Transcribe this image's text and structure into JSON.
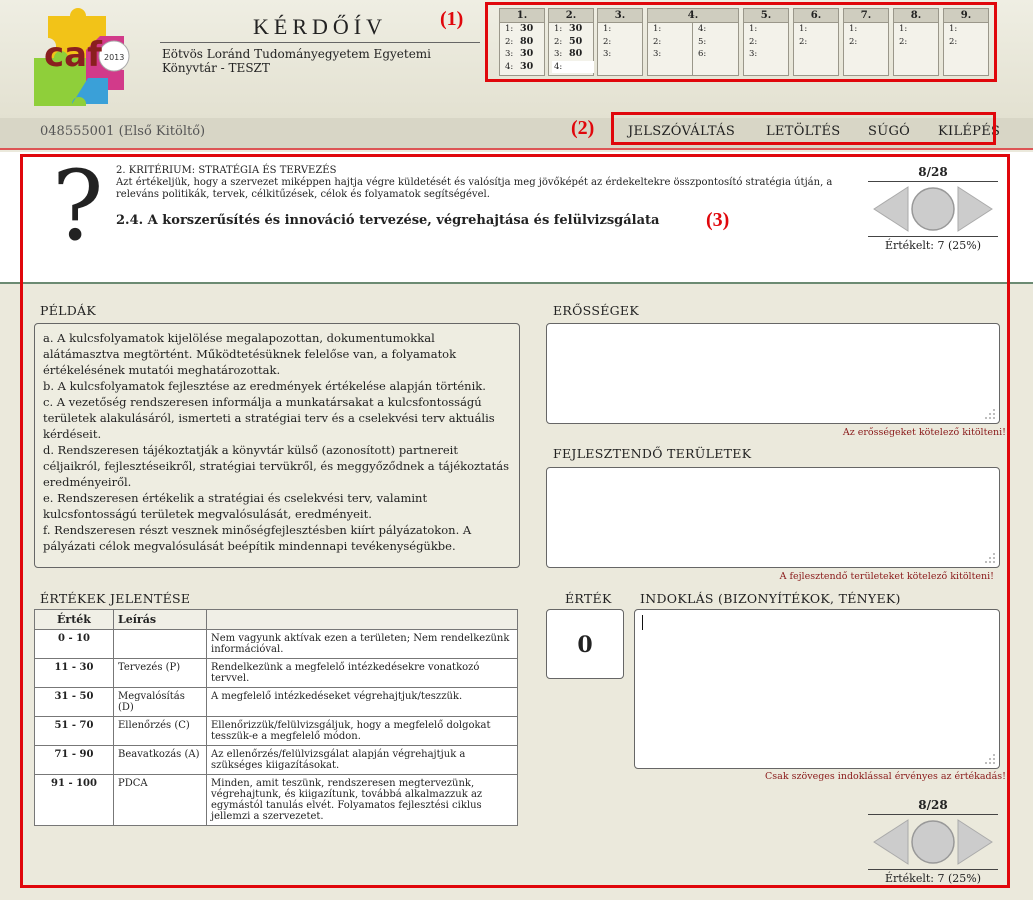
{
  "header": {
    "title": "KÉRDŐÍV",
    "subtitle": "Eötvös Loránd Tudományegyetem Egyetemi Könyvtár - TESZT",
    "logo_text": "caf",
    "logo_year": "2013"
  },
  "nav_grid": {
    "categories": [
      {
        "label": "1.",
        "items": [
          {
            "n": "1:",
            "v": "30"
          },
          {
            "n": "2:",
            "v": "80"
          },
          {
            "n": "3:",
            "v": "30"
          },
          {
            "n": "4:",
            "v": "30"
          }
        ]
      },
      {
        "label": "2.",
        "items": [
          {
            "n": "1:",
            "v": "30"
          },
          {
            "n": "2:",
            "v": "50"
          },
          {
            "n": "3:",
            "v": "80"
          },
          {
            "n": "4:",
            "v": ""
          }
        ]
      },
      {
        "label": "3.",
        "items": [
          {
            "n": "1:",
            "v": ""
          },
          {
            "n": "2:",
            "v": ""
          },
          {
            "n": "3:",
            "v": ""
          }
        ]
      },
      {
        "label": "4.",
        "items": [
          {
            "n": "1:",
            "v": ""
          },
          {
            "n": "2:",
            "v": ""
          },
          {
            "n": "3:",
            "v": ""
          },
          {
            "n": "4:",
            "v": ""
          },
          {
            "n": "5:",
            "v": ""
          },
          {
            "n": "6:",
            "v": ""
          }
        ]
      },
      {
        "label": "5.",
        "items": [
          {
            "n": "1:",
            "v": ""
          },
          {
            "n": "2:",
            "v": ""
          },
          {
            "n": "3:",
            "v": ""
          }
        ]
      },
      {
        "label": "6.",
        "items": [
          {
            "n": "1:",
            "v": ""
          },
          {
            "n": "2:",
            "v": ""
          }
        ]
      },
      {
        "label": "7.",
        "items": [
          {
            "n": "1:",
            "v": ""
          },
          {
            "n": "2:",
            "v": ""
          }
        ]
      },
      {
        "label": "8.",
        "items": [
          {
            "n": "1:",
            "v": ""
          },
          {
            "n": "2:",
            "v": ""
          }
        ]
      },
      {
        "label": "9.",
        "items": [
          {
            "n": "1:",
            "v": ""
          },
          {
            "n": "2:",
            "v": ""
          }
        ]
      }
    ]
  },
  "annotations": {
    "a1": "(1)",
    "a2": "(2)",
    "a3": "(3)"
  },
  "user": "048555001 (Első Kitöltő)",
  "menu": {
    "password": "JELSZÓVÁLTÁS",
    "download": "LETÖLTÉS",
    "help": "SÚGÓ",
    "logout": "KILÉPÉS"
  },
  "question": {
    "qmark": "?",
    "criterion": "2. KRITÉRIUM: STRATÉGIA ÉS TERVEZÉS",
    "criterion_desc": "Azt értékeljük, hogy a szervezet miképpen hajtja végre küldetését és valósítja meg jövőképét az érdekeltekre összpontosító stratégia útján, a releváns politikák, tervek, célkitűzések, célok és folyamatok segítségével.",
    "subcriterion": "2.4. A korszerűsítés és innováció tervezése, végrehajtása és felülvizsgálata"
  },
  "pager": {
    "position": "8/28",
    "rated": "Értékelt: 7 (25%)"
  },
  "sections": {
    "examples_title": "PÉLDÁK",
    "strengths_title": "ERŐSSÉGEK",
    "strengths_error": "Az erősségeket kötelező kitölteni!",
    "improve_title": "FEJLESZTENDŐ TERÜLETEK",
    "improve_error": "A fejlesztendő területeket kötelező kitölteni!",
    "values_title": "ÉRTÉKEK JELENTÉSE",
    "value_title": "ÉRTÉK",
    "reason_title": "INDOKLÁS (BIZONYÍTÉKOK, TÉNYEK)",
    "reason_error": "Csak szöveges indoklással érvényes az értékadás!"
  },
  "examples": [
    "a. A kulcsfolyamatok kijelölése megalapozottan, dokumentumokkal alátámasztva megtörtént. Működtetésüknek felelőse van, a folyamatok értékelésének mutatói meghatározottak.",
    "b. A kulcsfolyamatok fejlesztése az eredmények értékelése alapján történik.",
    "c. A vezetőség rendszeresen informálja a munkatársakat a kulcsfontosságú területek alakulásáról, ismerteti a stratégiai terv és a cselekvési terv aktuális kérdéseit.",
    "d. Rendszeresen tájékoztatják a könyvtár külső (azonosított) partnereit céljaikról, fejlesztéseikről, stratégiai tervükről, és meggyőződnek a tájékoztatás eredményeiről.",
    "e. Rendszeresen értékelik a stratégiai és cselekvési terv, valamint kulcsfontosságú területek megvalósulását, eredményeit.",
    "f. Rendszeresen részt vesznek minőségfejlesztésben kiírt pályázatokon. A pályázati célok megvalósulását beépítik mindennapi tevékenységükbe."
  ],
  "values_table": {
    "headers": [
      "Érték",
      "Leírás",
      ""
    ],
    "rows": [
      {
        "range": "0 - 10",
        "label": "",
        "desc": "Nem vagyunk aktívak ezen a területen; Nem rendelkezünk információval."
      },
      {
        "range": "11 - 30",
        "label": "Tervezés (P)",
        "desc": "Rendelkezünk a megfelelő intézkedésekre vonatkozó tervvel."
      },
      {
        "range": "31 - 50",
        "label": "Megvalósítás (D)",
        "desc": "A megfelelő intézkedéseket végrehajtjuk/teszzük."
      },
      {
        "range": "51 - 70",
        "label": "Ellenőrzés (C)",
        "desc": "Ellenőrizzük/felülvizsgáljuk, hogy a megfelelő dolgokat tesszük-e a megfelelő módon."
      },
      {
        "range": "71 - 90",
        "label": "Beavatkozás (A)",
        "desc": "Az ellenőrzés/felülvizsgálat alapján végrehajtjuk a szükséges kiigazításokat."
      },
      {
        "range": "91 - 100",
        "label": "PDCA",
        "desc": "Minden, amit teszünk, rendszeresen megtervezünk, végrehajtunk, és kiigazítunk, továbbá alkalmazzuk az egymástól tanulás elvét. Folyamatos fejlesztési ciklus jellemzi a szervezetet."
      }
    ]
  },
  "value": "0",
  "colors": {
    "accent_red": "#e0070c",
    "header_bg": "#efeee3",
    "divider": "#6b8a72"
  }
}
